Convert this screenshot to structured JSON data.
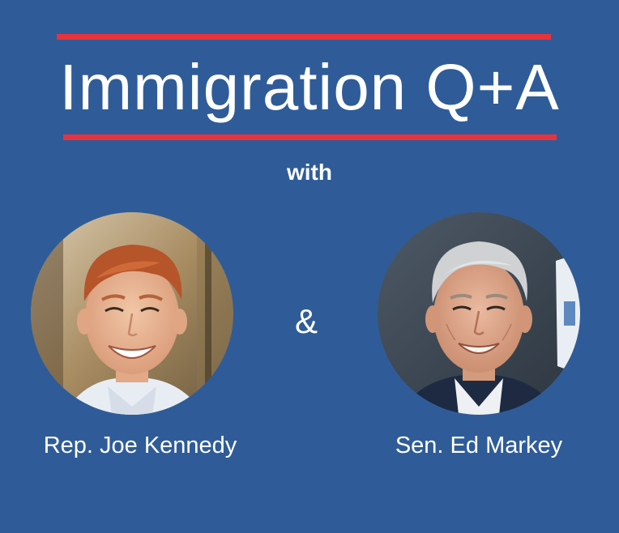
{
  "graphic": {
    "title": "Immigration Q+A",
    "connector": "with",
    "ampersand": "&",
    "colors": {
      "background": "#2f5c98",
      "accent_rule": "#e8333d",
      "text": "#ffffff"
    }
  },
  "speakers": [
    {
      "name": "Rep. Joe Kennedy",
      "photo_description": "smiling man with red hair, outdoor background"
    },
    {
      "name": "Sen. Ed Markey",
      "photo_description": "smiling older man with grey hair in suit"
    }
  ]
}
